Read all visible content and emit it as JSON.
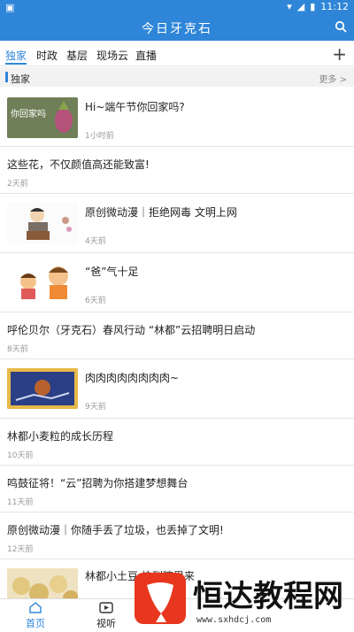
{
  "status_bar": {
    "left_icon": "notification-icon",
    "time": "11:12"
  },
  "app_bar": {
    "title": "今日牙克石",
    "search_icon": "search-icon"
  },
  "tabs": [
    {
      "label": "独家",
      "active": true
    },
    {
      "label": "时政",
      "active": false
    },
    {
      "label": "基层",
      "active": false
    },
    {
      "label": "现场云",
      "active": false
    },
    {
      "label": "直播",
      "active": false
    }
  ],
  "add_tab_label": "+",
  "section": {
    "title": "独家",
    "more": "更多 >"
  },
  "articles": [
    {
      "title": "Hi~端午节你回家吗?",
      "time": "1小时前",
      "has_image": true,
      "image_text": "你回家吗"
    },
    {
      "title": "这些花，不仅颜值高还能致富!",
      "time": "2天前",
      "has_image": false
    },
    {
      "title": "原创微动漫｜拒绝网毒 文明上网",
      "time": "4天前",
      "has_image": true
    },
    {
      "title": "“爸”气十足",
      "time": "6天前",
      "has_image": true
    },
    {
      "title": "呼伦贝尔（牙克石）春风行动 “林都”云招聘明日启动",
      "time": "8天前",
      "has_image": false
    },
    {
      "title": "肉肉肉肉肉肉肉肉~",
      "time": "9天前",
      "has_image": true
    },
    {
      "title": "林都小麦粒的成长历程",
      "time": "10天前",
      "has_image": false
    },
    {
      "title": "鸣鼓征将！“云”招聘为你搭建梦想舞台",
      "time": "11天前",
      "has_image": false
    },
    {
      "title": "原创微动漫｜你随手丢了垃圾，也丢掉了文明!",
      "time": "12天前",
      "has_image": false
    },
    {
      "title": "林都小土豆 快到碗里来",
      "time": "",
      "has_image": true
    }
  ],
  "bottom_nav": [
    {
      "label": "首页",
      "icon": "home-icon",
      "active": true
    },
    {
      "label": "视听",
      "icon": "video-icon",
      "active": false
    }
  ],
  "watermark": {
    "text": "恒达教程网",
    "url": "www.sxhdcj.com"
  }
}
